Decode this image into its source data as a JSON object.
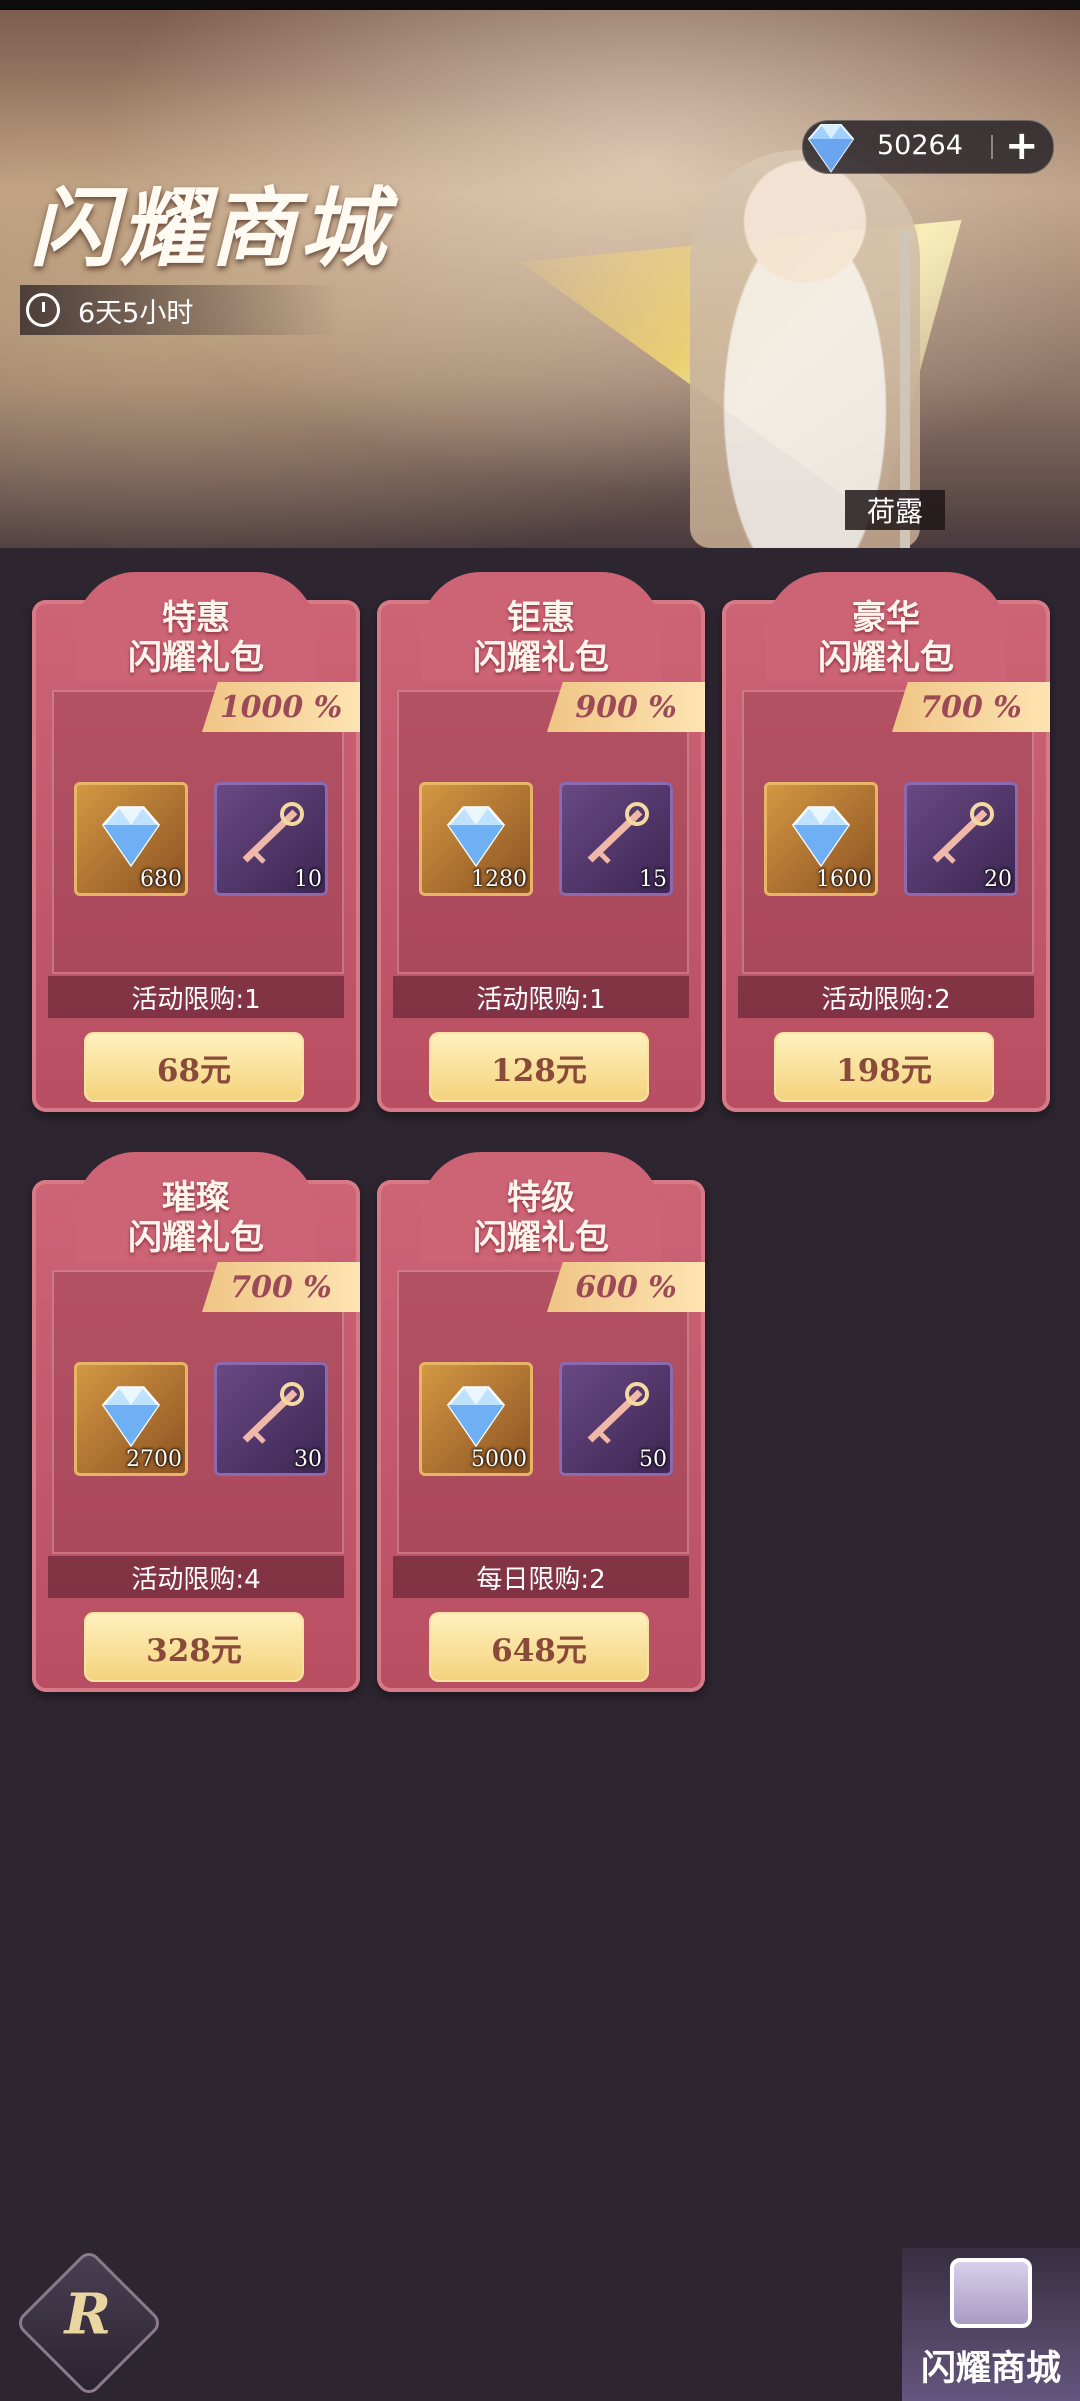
{
  "header": {
    "title": "闪耀商城",
    "timer": "6天5小时",
    "hero_name": "荷露",
    "currency_amount": "50264",
    "add_label": "+"
  },
  "packs": [
    {
      "name_line1": "特惠",
      "name_line2": "闪耀礼包",
      "bonus": "1000 %",
      "gem_qty": "680",
      "key_qty": "10",
      "limit": "活动限购:1",
      "price": "68元"
    },
    {
      "name_line1": "钜惠",
      "name_line2": "闪耀礼包",
      "bonus": "900 %",
      "gem_qty": "1280",
      "key_qty": "15",
      "limit": "活动限购:1",
      "price": "128元"
    },
    {
      "name_line1": "豪华",
      "name_line2": "闪耀礼包",
      "bonus": "700 %",
      "gem_qty": "1600",
      "key_qty": "20",
      "limit": "活动限购:2",
      "price": "198元"
    },
    {
      "name_line1": "璀璨",
      "name_line2": "闪耀礼包",
      "bonus": "700 %",
      "gem_qty": "2700",
      "key_qty": "30",
      "limit": "活动限购:4",
      "price": "328元"
    },
    {
      "name_line1": "特级",
      "name_line2": "闪耀礼包",
      "bonus": "600 %",
      "gem_qty": "5000",
      "key_qty": "50",
      "limit": "每日限购:2",
      "price": "648元"
    }
  ],
  "bottom": {
    "shop_tab_label": "闪耀商城"
  }
}
